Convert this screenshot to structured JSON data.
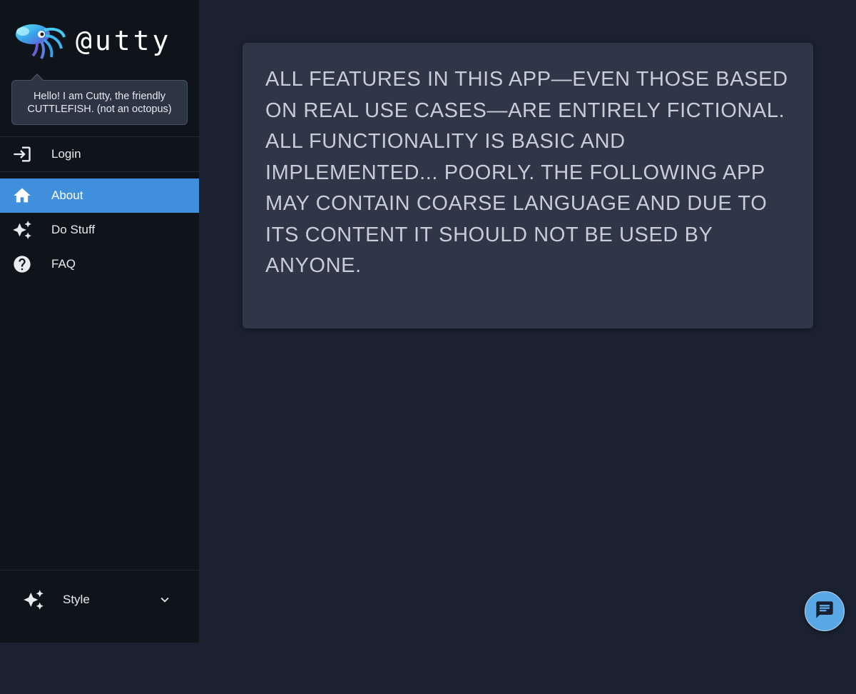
{
  "app": {
    "logo_text": "@utty",
    "mascot_icon": "cuttlefish-icon"
  },
  "tooltip": {
    "line1": "Hello! I am Cutty, the friendly",
    "line2": "CUTTLEFISH. (not an octopus)"
  },
  "nav": {
    "login": {
      "label": "Login",
      "icon": "login-icon"
    },
    "items": [
      {
        "label": "About",
        "icon": "home-icon",
        "active": true
      },
      {
        "label": "Do Stuff",
        "icon": "sparkles-icon",
        "active": false
      },
      {
        "label": "FAQ",
        "icon": "help-circle-icon",
        "active": false
      }
    ]
  },
  "style_menu": {
    "label": "Style",
    "icon": "sparkles-icon",
    "toggle_icon": "chevron-down-icon"
  },
  "main": {
    "disclaimer": "ALL FEATURES IN THIS APP—EVEN THOSE BASED ON REAL USE CASES—ARE ENTIRELY FICTIONAL. ALL FUNCTIONALITY IS BASIC AND IMPLEMENTED... POORLY. THE FOLLOWING APP MAY CONTAIN COARSE LANGUAGE AND DUE TO ITS CONTENT IT SHOULD NOT BE USED BY ANYONE."
  },
  "chat_button": {
    "icon": "chat-icon"
  },
  "colors": {
    "sidebar_bg": "#0f141b",
    "page_bg": "#1b2130",
    "card_bg": "#2e3647",
    "accent": "#3f8fdc",
    "fab": "#5aa7e6"
  }
}
